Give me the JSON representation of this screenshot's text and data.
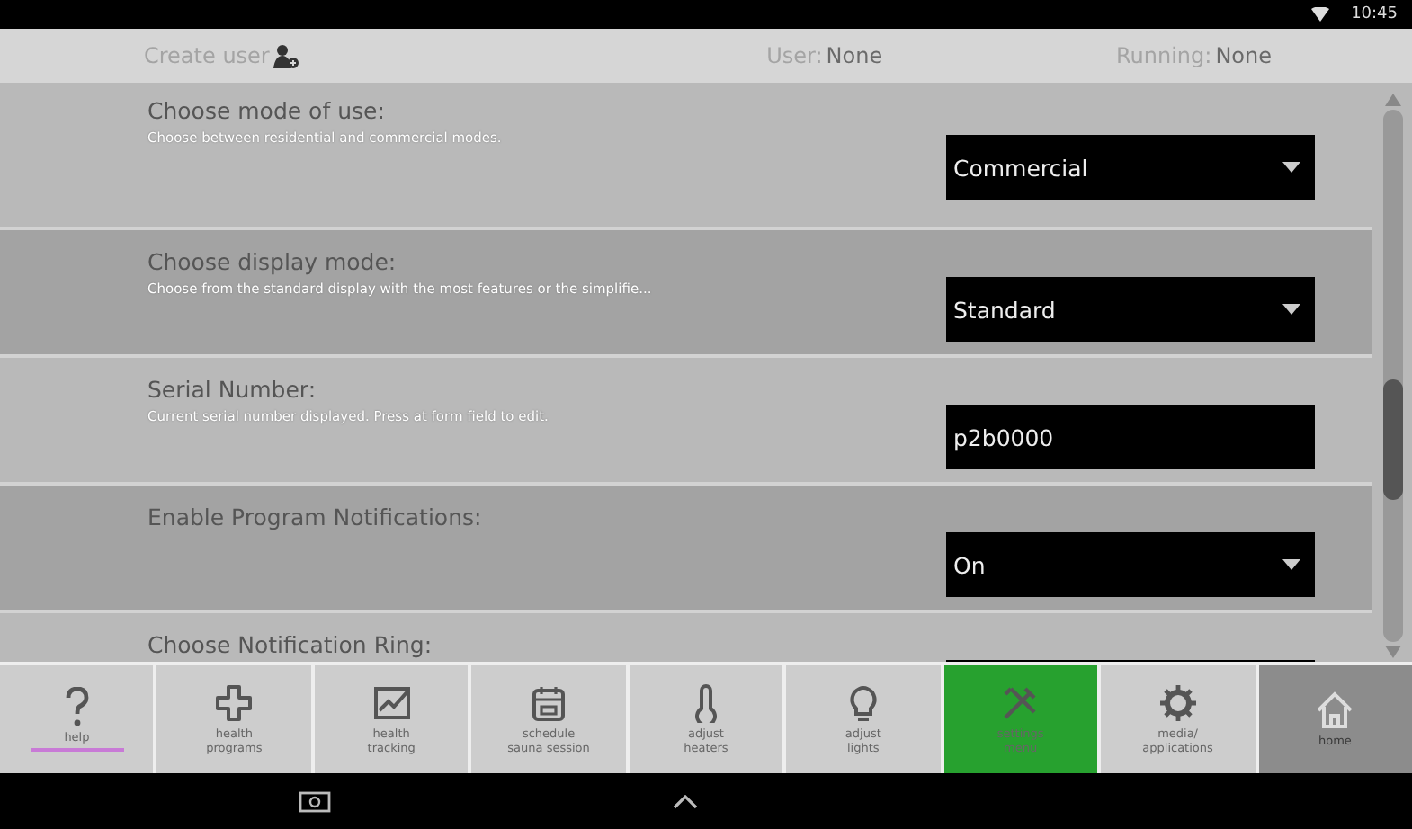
{
  "status_bar": {
    "time": "10:45"
  },
  "header": {
    "create_user": "Create user",
    "user_label": "User:",
    "user_value": "None",
    "running_label": "Running:",
    "running_value": "None"
  },
  "settings": [
    {
      "title": "Choose mode of use:",
      "description": "Choose between residential and commercial modes.",
      "kind": "dropdown",
      "value": "Commercial",
      "shaded": false
    },
    {
      "title": "Choose display mode:",
      "description": "Choose from the standard display with the most features or the simplifie...",
      "kind": "dropdown",
      "value": "Standard",
      "shaded": true
    },
    {
      "title": "Serial Number:",
      "description": "Current serial number displayed. Press at form field to edit.",
      "kind": "text",
      "value": "p2b0000",
      "shaded": false
    },
    {
      "title": "Enable Program Notifications:",
      "kind": "dropdown",
      "value": "On",
      "shaded": true
    },
    {
      "title": "Choose Notification Ring:",
      "kind": "dropdown",
      "shaded": false
    }
  ],
  "nav": [
    {
      "label": "help",
      "selected": false,
      "highlighted": true,
      "kind": "item"
    },
    {
      "label": "health\nprograms",
      "selected": false,
      "highlighted": false,
      "kind": "item"
    },
    {
      "label": "health\ntracking",
      "selected": false,
      "highlighted": false,
      "kind": "item"
    },
    {
      "label": "schedule\nsauna session",
      "selected": false,
      "highlighted": false,
      "kind": "item"
    },
    {
      "label": "adjust\nheaters",
      "selected": false,
      "highlighted": false,
      "kind": "item"
    },
    {
      "label": "adjust\nlights",
      "selected": false,
      "highlighted": false,
      "kind": "item"
    },
    {
      "label": "settings\nmenu",
      "selected": true,
      "highlighted": false,
      "kind": "item"
    },
    {
      "label": "media/\napplications",
      "selected": false,
      "highlighted": false,
      "kind": "item"
    },
    {
      "label": "home",
      "selected": false,
      "highlighted": false,
      "kind": "home"
    }
  ]
}
